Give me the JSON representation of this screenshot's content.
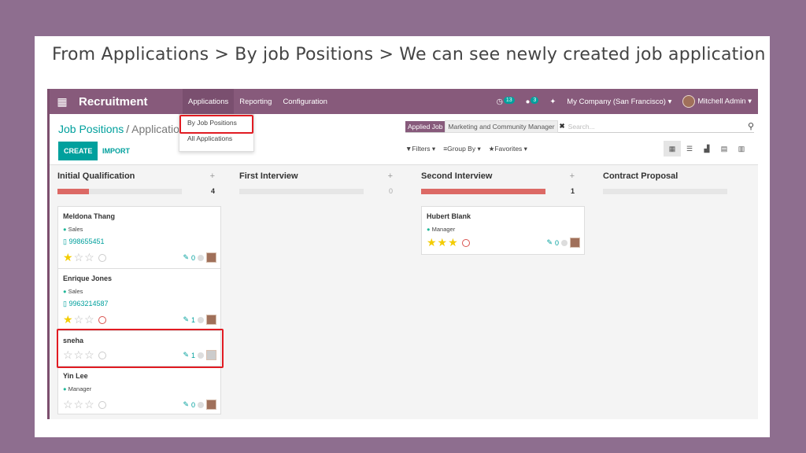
{
  "caption": "From Applications > By job Positions > We can see newly created job application",
  "navbar": {
    "app_name": "Recruitment",
    "menu": [
      "Applications",
      "Reporting",
      "Configuration"
    ],
    "activity_count": "13",
    "message_count": "3",
    "company": "My Company (San Francisco) ▾",
    "user": "Mitchell Admin ▾"
  },
  "dropdown": {
    "items": [
      "By Job Positions",
      "All Applications"
    ]
  },
  "control_panel": {
    "breadcrumb_root": "Job Positions",
    "breadcrumb_current": "Application",
    "create_label": "CREATE",
    "import_label": "IMPORT",
    "facet_label": "Applied Job",
    "facet_value": "Marketing and Community Manager",
    "search_placeholder": "Search...",
    "filters_label": "Filters ▾",
    "groupby_label": "Group By ▾",
    "favorites_label": "Favorites ▾"
  },
  "columns": [
    {
      "title": "Initial Qualification",
      "count": "4",
      "progress": 0.25
    },
    {
      "title": "First Interview",
      "count": "0",
      "progress": 0
    },
    {
      "title": "Second Interview",
      "count": "1",
      "progress": 1.0
    },
    {
      "title": "Contract Proposal",
      "count": "",
      "progress": 0
    }
  ],
  "cards": [
    {
      "name": "Meldona Thang",
      "tag": "Sales",
      "phone": "998655451",
      "stars": 1,
      "attachments": "0"
    },
    {
      "name": "Enrique Jones",
      "tag": "Sales",
      "phone": "9963214587",
      "stars": 1,
      "attachments": "1"
    },
    {
      "name": "sneha",
      "tag": "",
      "phone": "",
      "stars": 0,
      "attachments": "1"
    },
    {
      "name": "Yin Lee",
      "tag": "Manager",
      "phone": "",
      "stars": 0,
      "attachments": "0"
    },
    {
      "name": "Hubert Blank",
      "tag": "Manager",
      "phone": "",
      "stars": 3,
      "attachments": "0"
    }
  ],
  "colors": {
    "brand": "#875a7b",
    "accent": "#00a09d",
    "highlight": "#e11b22"
  }
}
